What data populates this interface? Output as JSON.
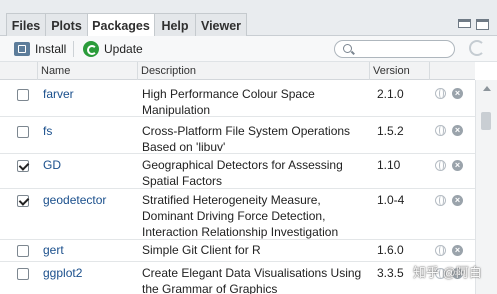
{
  "tabs": [
    {
      "label": "Files"
    },
    {
      "label": "Plots"
    },
    {
      "label": "Packages"
    },
    {
      "label": "Help"
    },
    {
      "label": "Viewer"
    }
  ],
  "toolbar": {
    "install_label": "Install",
    "update_label": "Update",
    "search_placeholder": ""
  },
  "table": {
    "headers": {
      "name": "Name",
      "description": "Description",
      "version": "Version"
    },
    "rows": [
      {
        "checked": false,
        "name": "farver",
        "description": "High Performance Colour Space Manipulation",
        "version": "2.1.0"
      },
      {
        "checked": false,
        "name": "fs",
        "description": "Cross-Platform File System Operations Based on 'libuv'",
        "version": "1.5.2"
      },
      {
        "checked": true,
        "name": "GD",
        "description": "Geographical Detectors for Assessing Spatial Factors",
        "version": "1.10"
      },
      {
        "checked": true,
        "name": "geodetector",
        "description": "Stratified Heterogeneity Measure, Dominant Driving Force Detection, Interaction Relationship Investigation",
        "version": "1.0-4"
      },
      {
        "checked": false,
        "name": "gert",
        "description": "Simple Git Client for R",
        "version": "1.6.0"
      },
      {
        "checked": false,
        "name": "ggplot2",
        "description": "Create Elegant Data Visualisations Using the Grammar of Graphics",
        "version": "3.3.5"
      }
    ]
  },
  "watermark": "知乎 @阿白",
  "colors": {
    "tab_bg": "#e9ecef",
    "package_link": "#1a4f8c",
    "update_green": "#2a9b3a"
  }
}
